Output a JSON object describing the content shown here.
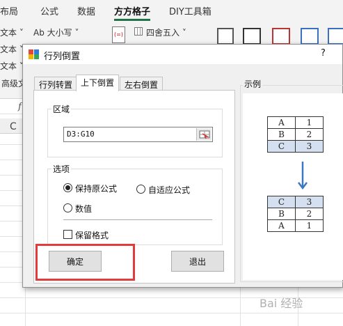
{
  "ribbon": {
    "tabs": [
      "布局",
      "公式",
      "数据",
      "方方格子",
      "DIY工具箱"
    ],
    "active_tab": "方方格子",
    "font_size_label": "Ab 大小写 ˅",
    "round_label": "四舍五入 ˅",
    "left_stub_1": "文本 ˅",
    "left_stub_2": "文本 ˅",
    "left_stub_3": "文本 ˅",
    "left_stub_4": "高级文",
    "formula_icon_text": "(=)",
    "accent_color": "#217346"
  },
  "sheet": {
    "column_c": "C",
    "formula_stub": "f"
  },
  "dialog": {
    "title": "行列倒置",
    "help": "?",
    "tabs": [
      "行列转置",
      "上下倒置",
      "左右倒置"
    ],
    "active_tab": "上下倒置",
    "region": {
      "label": "区域",
      "value": "D3:G10",
      "picker_icon": "range-picker-icon"
    },
    "options": {
      "label": "选项",
      "keep_formula": "保持原公式",
      "adaptive_formula": "自适应公式",
      "values_only": "数值",
      "selected": "保持原公式",
      "keep_format": "保留格式",
      "keep_format_checked": false
    },
    "buttons": {
      "ok": "确定",
      "exit": "退出"
    },
    "highlight_color": "#e23b3b",
    "example": {
      "label": "示例",
      "before": [
        [
          "A",
          "1"
        ],
        [
          "B",
          "2"
        ],
        [
          "C",
          "3"
        ]
      ],
      "after": [
        [
          "C",
          "3"
        ],
        [
          "B",
          "2"
        ],
        [
          "A",
          "1"
        ]
      ],
      "arrow_color": "#3c78c0",
      "highlight_color": "#d4dfef"
    }
  },
  "watermark": "Bai 经验"
}
